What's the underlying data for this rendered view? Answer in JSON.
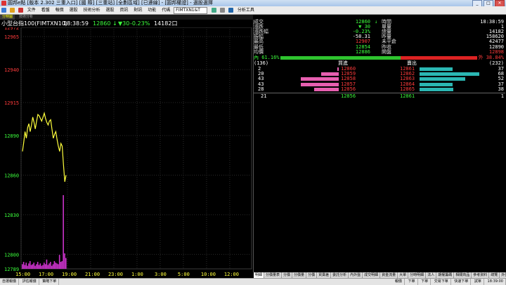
{
  "window": {
    "title": "圓邦e點 [版本 2.302 三重入口] [國 際] [三重站] [全劃區域] [已連線] - [圓邦權證] - 選股選擇",
    "controls": [
      "_",
      "□",
      "✕"
    ]
  },
  "toolbar": {
    "menu_items": [
      "文件",
      "看盤",
      "報價",
      "選股",
      "技術分析",
      "選股",
      "資訊",
      "財訊",
      "功能",
      "代碼"
    ],
    "code_input": "FIMTXN1&T",
    "right_items": [
      "分析工具"
    ]
  },
  "chart_tabs": [
    "分時圖",
    "技術分析"
  ],
  "chart_header": {
    "name": "小型台指100(FIMTXN10)",
    "time": "18:38:59",
    "price": "12860",
    "change": "▼30",
    "pct": "-0.23%",
    "volume": "14182口"
  },
  "chart_data": {
    "type": "line",
    "title": "",
    "xlabel": "",
    "ylabel": "",
    "ylim": [
      12789,
      12972
    ],
    "y_ticks": [
      12972,
      12965,
      12940,
      12915,
      12890,
      12860,
      12830,
      12800,
      12789
    ],
    "y_ticks_red": [
      12972,
      12965,
      12940,
      12915
    ],
    "y_ticks_green": [
      12890,
      12860,
      12830,
      12800,
      12789
    ],
    "x_ticks": [
      "15:00",
      "17:00",
      "19:00",
      "21:00",
      "23:00",
      "1:00",
      "3:00",
      "5:00",
      "10:00",
      "12:00"
    ],
    "reference_price": 12890,
    "series": [
      {
        "values": [
          12878,
          12885,
          12893,
          12888,
          12896,
          12899,
          12893,
          12898,
          12904,
          12900,
          12895,
          12901,
          12906,
          12905,
          12903,
          12901,
          12904,
          12907,
          12903,
          12900,
          12898,
          12901,
          12902,
          12895,
          12888,
          12891,
          12893,
          12887,
          12882,
          12878,
          12884,
          12882,
          12868,
          12855,
          12860
        ]
      }
    ],
    "volume_bars": [
      6,
      9,
      5,
      8,
      4,
      7,
      10,
      5,
      6,
      8,
      4,
      6,
      9,
      5,
      7,
      4,
      5,
      8,
      6,
      12,
      5,
      7,
      9,
      4,
      6,
      10,
      8,
      7,
      6,
      18,
      9,
      10,
      95,
      20,
      14
    ]
  },
  "quote": {
    "rows": [
      {
        "l1": "成交",
        "v1": "12860",
        "a1": "↓",
        "l2": "時間",
        "v2": "18:38:59",
        "c1": "green",
        "c2": "white"
      },
      {
        "l1": "漲跌",
        "v1": "▼ 30",
        "a1": "",
        "l2": "單量",
        "v2": "1",
        "c1": "green",
        "c2": "white"
      },
      {
        "l1": "漲跌幅",
        "v1": "-0.23%",
        "a1": "",
        "l2": "總量",
        "v2": "14182",
        "c1": "green",
        "c2": "white"
      },
      {
        "l1": "振幅",
        "v1": "-58.31",
        "a1": "",
        "l2": "昨量",
        "v2": "158620",
        "c1": "white",
        "c2": "white"
      },
      {
        "l1": "最高",
        "v1": "12907",
        "a1": "",
        "l2": "未平倉",
        "v2": "42477",
        "c1": "red",
        "c2": "white"
      },
      {
        "l1": "最低",
        "v1": "12854",
        "a1": "",
        "l2": "昨收",
        "v2": "12890",
        "c1": "green",
        "c2": "white"
      },
      {
        "l1": "均價",
        "v1": "12886",
        "a1": "",
        "l2": "開盤",
        "v2": "12898",
        "c1": "green",
        "c2": "red"
      }
    ],
    "ratio_left": "內 61.16%",
    "ratio_right": "外 38.84%",
    "ratio_value": 61.16,
    "book_header": {
      "left_total": "(136)",
      "bid_label": "買進",
      "ask_label": "賣出",
      "right_total": "(232)"
    },
    "book": [
      {
        "bid_qty": "2",
        "bid": "12860",
        "ask": "12861",
        "ask_qty": "37",
        "bid_bar": 2,
        "ask_bar": 37
      },
      {
        "bid_qty": "20",
        "bid": "12859",
        "ask": "12862",
        "ask_qty": "68",
        "bid_bar": 20,
        "ask_bar": 68
      },
      {
        "bid_qty": "43",
        "bid": "12858",
        "ask": "12863",
        "ask_qty": "52",
        "bid_bar": 43,
        "ask_bar": 52
      },
      {
        "bid_qty": "43",
        "bid": "12857",
        "ask": "12864",
        "ask_qty": "37",
        "bid_bar": 43,
        "ask_bar": 37
      },
      {
        "bid_qty": "28",
        "bid": "12856",
        "ask": "12865",
        "ask_qty": "38",
        "bid_bar": 28,
        "ask_bar": 38
      }
    ],
    "last": {
      "qty": "21",
      "bid": "12856",
      "ask": "12861",
      "ask_qty": "1"
    }
  },
  "bottom_tabs": [
    "明細",
    "分價量表",
    "分價",
    "分價量",
    "分價",
    "買賣差",
    "委託分析",
    "內外盤",
    "成交明細",
    "資金流量",
    "大單",
    "分時明細",
    "法人",
    "期權籌碼",
    "相關商品",
    "參考資料",
    "總覽",
    "外盤"
  ],
  "status_bar": {
    "left": [
      "自選報價",
      "評估報價",
      "策略下單"
    ],
    "right": [
      "報價",
      "下單",
      "下單",
      "交易下單",
      "快速下單",
      "試單",
      "18:39:00"
    ]
  },
  "colors": {
    "accent_red": "#ff3b3b",
    "accent_green": "#3cff3c",
    "price_line": "#ffff3c",
    "volume": "#cc33cc",
    "bid_bar": "#e75fb0",
    "ask_bar": "#2bb7b3"
  }
}
